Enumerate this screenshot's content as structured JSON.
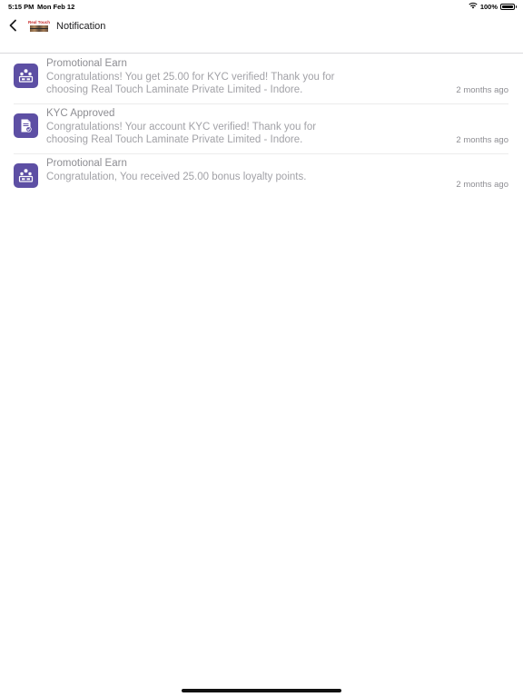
{
  "status_bar": {
    "time": "5:15 PM",
    "date": "Mon Feb 12",
    "battery": "100%",
    "battery_level": 1.0
  },
  "header": {
    "back_icon": "chevron-left-icon",
    "logo_text": "Real Touch",
    "title": "Notification"
  },
  "colors": {
    "icon_background": "#5d4fa4",
    "title_text": "#8e8e93",
    "message_text": "#a2a2a7",
    "divider": "#ececec"
  },
  "notifications": [
    {
      "icon": "promotional-earn-icon",
      "title": "Promotional Earn",
      "message": "Congratulations! You get 25.00 for KYC verified! Thank you for choosing Real Touch Laminate Private Limited - Indore.",
      "time": "2 months ago"
    },
    {
      "icon": "kyc-document-icon",
      "title": "KYC Approved",
      "message": "Congratulations! Your account KYC verified! Thank you for choosing Real Touch Laminate Private Limited - Indore.",
      "time": "2 months ago"
    },
    {
      "icon": "promotional-earn-icon",
      "title": "Promotional Earn",
      "message": "Congratulation, You received 25.00 bonus loyalty points.",
      "time": "2 months ago"
    }
  ]
}
